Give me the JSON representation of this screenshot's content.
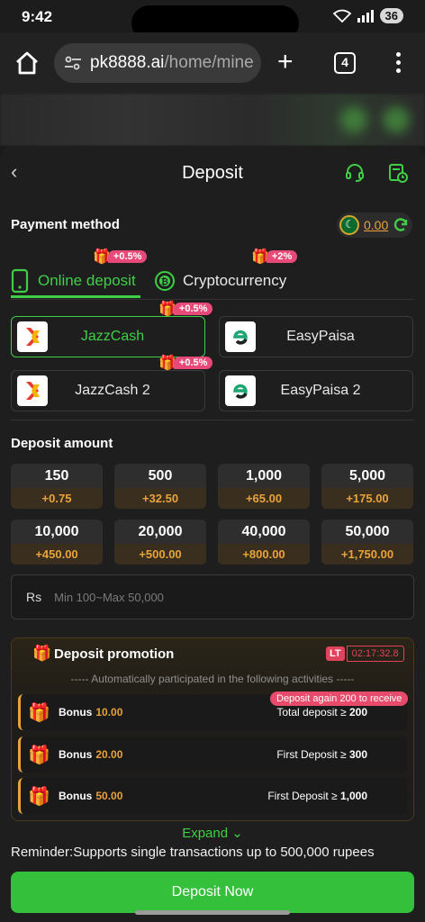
{
  "status_bar": {
    "time": "9:42",
    "battery": "36"
  },
  "browser": {
    "url_host": "pk8888.ai",
    "url_path": "/home/mine",
    "tab_count": "4"
  },
  "header": {
    "title": "Deposit"
  },
  "payment": {
    "label": "Payment method",
    "balance": "0.00",
    "tabs": [
      {
        "label": "Online deposit",
        "badge": "+0.5%",
        "active": true
      },
      {
        "label": "Cryptocurrency",
        "badge": "+2%",
        "active": false
      }
    ],
    "channels": [
      {
        "name": "JazzCash",
        "badge": "+0.5%",
        "active": true,
        "logo": "jazzcash-logo"
      },
      {
        "name": "EasyPaisa",
        "badge": "",
        "active": false,
        "logo": "easypaisa-logo"
      },
      {
        "name": "JazzCash 2",
        "badge": "+0.5%",
        "active": false,
        "logo": "jazzcash-logo"
      },
      {
        "name": "EasyPaisa 2",
        "badge": "",
        "active": false,
        "logo": "easypaisa-logo"
      }
    ]
  },
  "deposit_amount": {
    "label": "Deposit amount",
    "options": [
      {
        "value": "150",
        "bonus": "+0.75"
      },
      {
        "value": "500",
        "bonus": "+32.50"
      },
      {
        "value": "1,000",
        "bonus": "+65.00"
      },
      {
        "value": "5,000",
        "bonus": "+175.00"
      },
      {
        "value": "10,000",
        "bonus": "+450.00"
      },
      {
        "value": "20,000",
        "bonus": "+500.00"
      },
      {
        "value": "40,000",
        "bonus": "+800.00"
      },
      {
        "value": "50,000",
        "bonus": "+1,750.00"
      }
    ],
    "currency": "Rs",
    "placeholder": "Min 100~Max 50,000"
  },
  "promotion": {
    "title": "Deposit promotion",
    "lt_label": "LT",
    "timer": "02:17:32.8",
    "subtitle": "----- Automatically participated in the following activities -----",
    "again_notice": "Deposit again 200 to receive",
    "rows": [
      {
        "bonus_label": "Bonus",
        "bonus_value": "10.00",
        "condition": "Total deposit ≥",
        "condition_value": "200"
      },
      {
        "bonus_label": "Bonus",
        "bonus_value": "20.00",
        "condition": "First Deposit ≥",
        "condition_value": "300"
      },
      {
        "bonus_label": "Bonus",
        "bonus_value": "50.00",
        "condition": "First Deposit ≥",
        "condition_value": "1,000"
      }
    ]
  },
  "expand_label": "Expand",
  "reminder": "Reminder:Supports single transactions up to 500,000 rupees",
  "deposit_button": "Deposit Now",
  "colors": {
    "accent_green": "#3fcf46",
    "bonus_orange": "#e9a33a",
    "badge_pink": "#e74a78"
  }
}
